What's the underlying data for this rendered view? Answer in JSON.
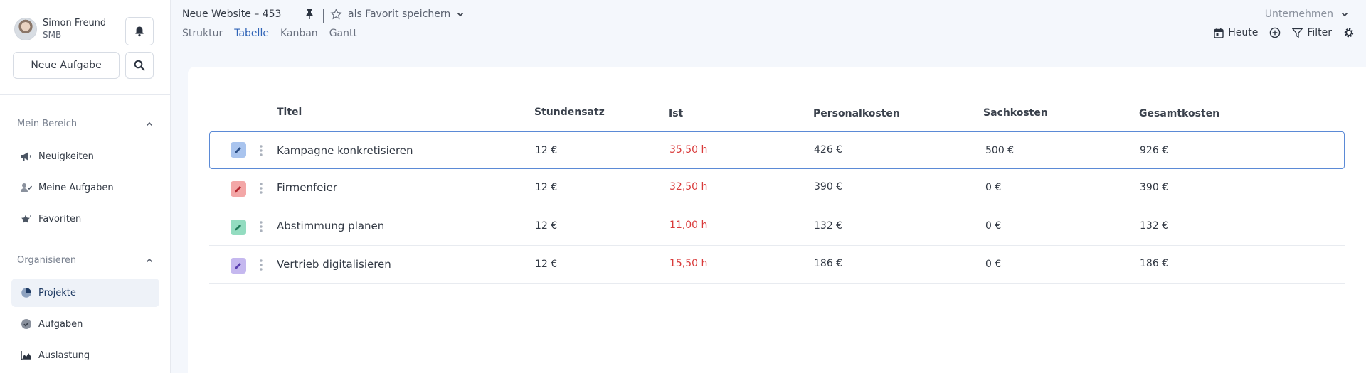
{
  "user": {
    "name": "Simon Freund",
    "org": "SMB"
  },
  "sidebar": {
    "new_task_label": "Neue Aufgabe",
    "sections": [
      {
        "label": "Mein Bereich",
        "items": [
          {
            "label": "Neuigkeiten",
            "icon": "megaphone-icon"
          },
          {
            "label": "Meine Aufgaben",
            "icon": "user-check-icon"
          },
          {
            "label": "Favoriten",
            "icon": "star-icon"
          }
        ]
      },
      {
        "label": "Organisieren",
        "items": [
          {
            "label": "Projekte",
            "icon": "pie-chart-icon",
            "active": true
          },
          {
            "label": "Aufgaben",
            "icon": "check-circle-icon"
          },
          {
            "label": "Auslastung",
            "icon": "area-chart-icon"
          }
        ]
      }
    ]
  },
  "header": {
    "project_title": "Neue Website – 453",
    "favorite_label": "als Favorit speichern",
    "tabs": [
      "Struktur",
      "Tabelle",
      "Kanban",
      "Gantt"
    ],
    "active_tab": "Tabelle",
    "company_label": "Unternehmen",
    "today_label": "Heute",
    "filter_label": "Filter"
  },
  "table": {
    "columns": [
      "Titel",
      "Stundensatz",
      "Ist",
      "Personalkosten",
      "Sachkosten",
      "Gesamtkosten"
    ],
    "rows": [
      {
        "title": "Kampagne konkretisieren",
        "rate": "12 €",
        "actual": "35,50 h",
        "personnel": "426 €",
        "material": "500 €",
        "total": "926 €",
        "color": "#a9c4ee",
        "pen": "#2c4f86",
        "selected": true
      },
      {
        "title": "Firmenfeier",
        "rate": "12 €",
        "actual": "32,50 h",
        "personnel": "390 €",
        "material": "0 €",
        "total": "390 €",
        "color": "#f3a7a7",
        "pen": "#b3262f"
      },
      {
        "title": "Abstimmung planen",
        "rate": "12 €",
        "actual": "11,00 h",
        "personnel": "132 €",
        "material": "0 €",
        "total": "132 €",
        "color": "#93dcc0",
        "pen": "#1f7a58"
      },
      {
        "title": "Vertrieb digitalisieren",
        "rate": "12 €",
        "actual": "15,50 h",
        "personnel": "186 €",
        "material": "0 €",
        "total": "186 €",
        "color": "#c5b8ef",
        "pen": "#5a3fb0"
      }
    ]
  },
  "colors": {
    "accent": "#2f63b7",
    "hours": "#d93a3a",
    "selected_border": "#5b8ad6"
  }
}
